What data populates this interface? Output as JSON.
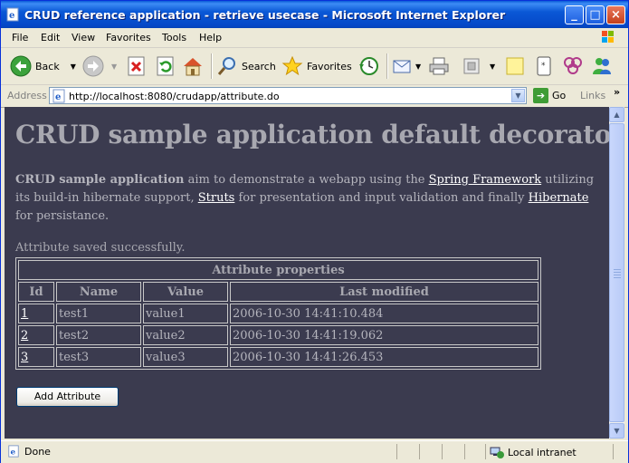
{
  "window": {
    "title": "CRUD reference application - retrieve usecase - Microsoft Internet Explorer"
  },
  "menu": [
    "File",
    "Edit",
    "View",
    "Favorites",
    "Tools",
    "Help"
  ],
  "toolbar": {
    "back": "Back",
    "search": "Search",
    "favorites": "Favorites"
  },
  "address": {
    "label": "Address",
    "url": "http://localhost:8080/crudapp/attribute.do",
    "go": "Go",
    "links": "Links",
    "more": "»"
  },
  "page": {
    "heading": "CRUD sample application default decorator",
    "intro_bold": "CRUD sample application",
    "intro_1": " aim to demonstrate a webapp using the ",
    "link_spring": "Spring Framework",
    "intro_2": " utilizing its build-in hibernate support, ",
    "link_struts": "Struts",
    "intro_3": " for presentation and input validation and finally ",
    "link_hibernate": "Hibernate",
    "intro_4": " for persistance.",
    "status_message": "Attribute saved successfully.",
    "table": {
      "caption": "Attribute properties",
      "headers": [
        "Id",
        "Name",
        "Value",
        "Last modified"
      ],
      "rows": [
        {
          "id": "1",
          "name": "test1",
          "value": "value1",
          "modified": "2006-10-30 14:41:10.484"
        },
        {
          "id": "2",
          "name": "test2",
          "value": "value2",
          "modified": "2006-10-30 14:41:19.062"
        },
        {
          "id": "3",
          "name": "test3",
          "value": "value3",
          "modified": "2006-10-30 14:41:26.453"
        }
      ]
    },
    "add_button": "Add Attribute"
  },
  "statusbar": {
    "status": "Done",
    "zone": "Local intranet"
  },
  "colors": {
    "page_background": "#3b3b4f",
    "titlebar": "#0a58d6"
  }
}
